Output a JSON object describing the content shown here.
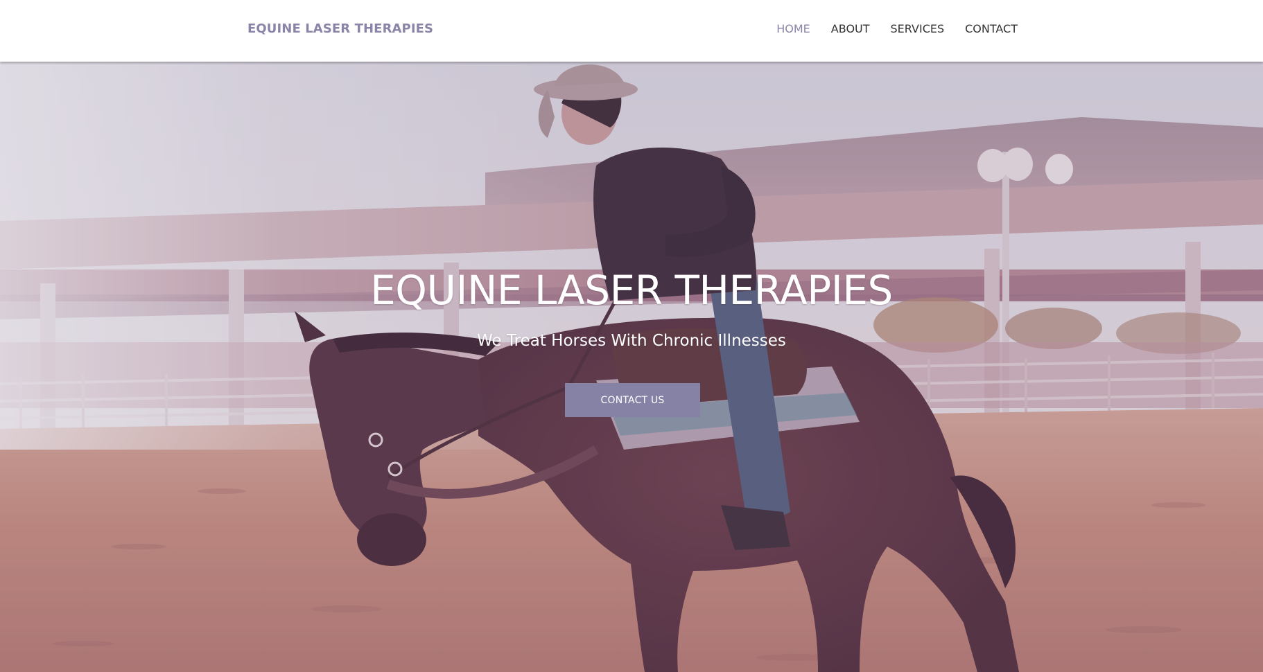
{
  "header": {
    "brand": "EQUINE LASER THERAPIES",
    "nav": [
      {
        "label": "HOME",
        "active": true
      },
      {
        "label": "ABOUT",
        "active": false
      },
      {
        "label": "SERVICES",
        "active": false
      },
      {
        "label": "CONTACT",
        "active": false
      }
    ]
  },
  "hero": {
    "title": "EQUINE LASER THERAPIES",
    "subtitle": "We Treat Horses With Chronic Illnesses",
    "button_label": "CONTACT US",
    "image": "horse-and-rider-photo"
  },
  "colors": {
    "brand": "#8a84a8",
    "nav_text": "#333333",
    "nav_active": "#8a84a8",
    "button_bg": "#8582a6",
    "hero_text": "#ffffff"
  }
}
